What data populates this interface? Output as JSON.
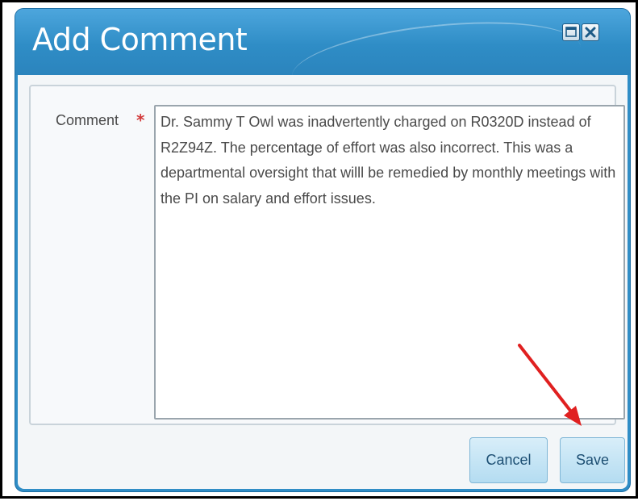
{
  "dialog": {
    "title": "Add Comment",
    "window_buttons": {
      "maximize_icon": "maximize-icon",
      "close_icon": "close-icon"
    }
  },
  "form": {
    "comment_label": "Comment",
    "required_marker": "*",
    "comment_value": "Dr. Sammy T Owl was inadvertently charged on R0320D instead of R2Z94Z. The percentage of effort was also incorrect. This was a departmental oversight that willl be remedied by monthly meetings with the PI on salary and effort issues."
  },
  "actions": {
    "cancel_label": "Cancel",
    "save_label": "Save"
  },
  "colors": {
    "title_bar": "#2f8dc6",
    "required_star": "#d23a3a",
    "annotation_arrow": "#e02020"
  }
}
